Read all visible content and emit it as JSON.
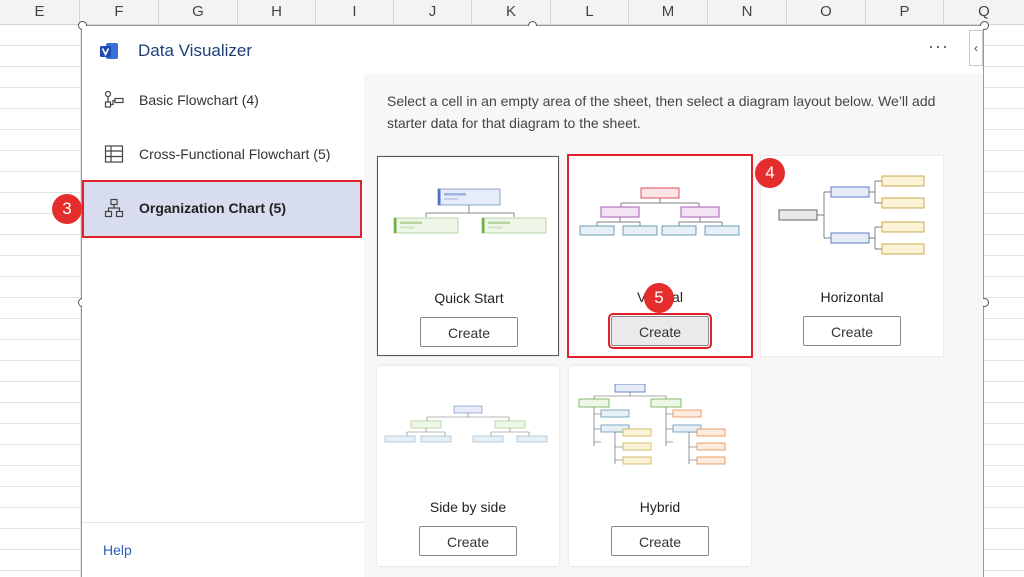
{
  "columns": [
    "E",
    "F",
    "G",
    "H",
    "I",
    "J",
    "K",
    "L",
    "M",
    "N",
    "O",
    "P",
    "Q"
  ],
  "app": {
    "title": "Data Visualizer",
    "more_label": "···",
    "collapse_label": "‹"
  },
  "sidebar": {
    "items": [
      {
        "label": "Basic Flowchart (4)",
        "icon": "flowchart-icon"
      },
      {
        "label": "Cross-Functional Flowchart (5)",
        "icon": "table-icon"
      },
      {
        "label": "Organization Chart (5)",
        "icon": "org-chart-icon"
      }
    ],
    "help_label": "Help"
  },
  "main": {
    "description": "Select a cell in an empty area of the sheet, then select a diagram layout below. We’ll add starter data for that diagram to the sheet.",
    "cards": [
      {
        "name": "Quick Start",
        "button": "Create"
      },
      {
        "name": "Vertical",
        "button": "Create"
      },
      {
        "name": "Horizontal",
        "button": "Create"
      },
      {
        "name": "Side by side",
        "button": "Create"
      },
      {
        "name": "Hybrid",
        "button": "Create"
      }
    ]
  },
  "annotations": {
    "badge_3": "3",
    "badge_4": "4",
    "badge_5": "5"
  },
  "colors": {
    "highlight": "#e0202a",
    "badge": "#e52d2d",
    "accent": "#1f3f7a",
    "selected_bg": "#d7dcee"
  }
}
